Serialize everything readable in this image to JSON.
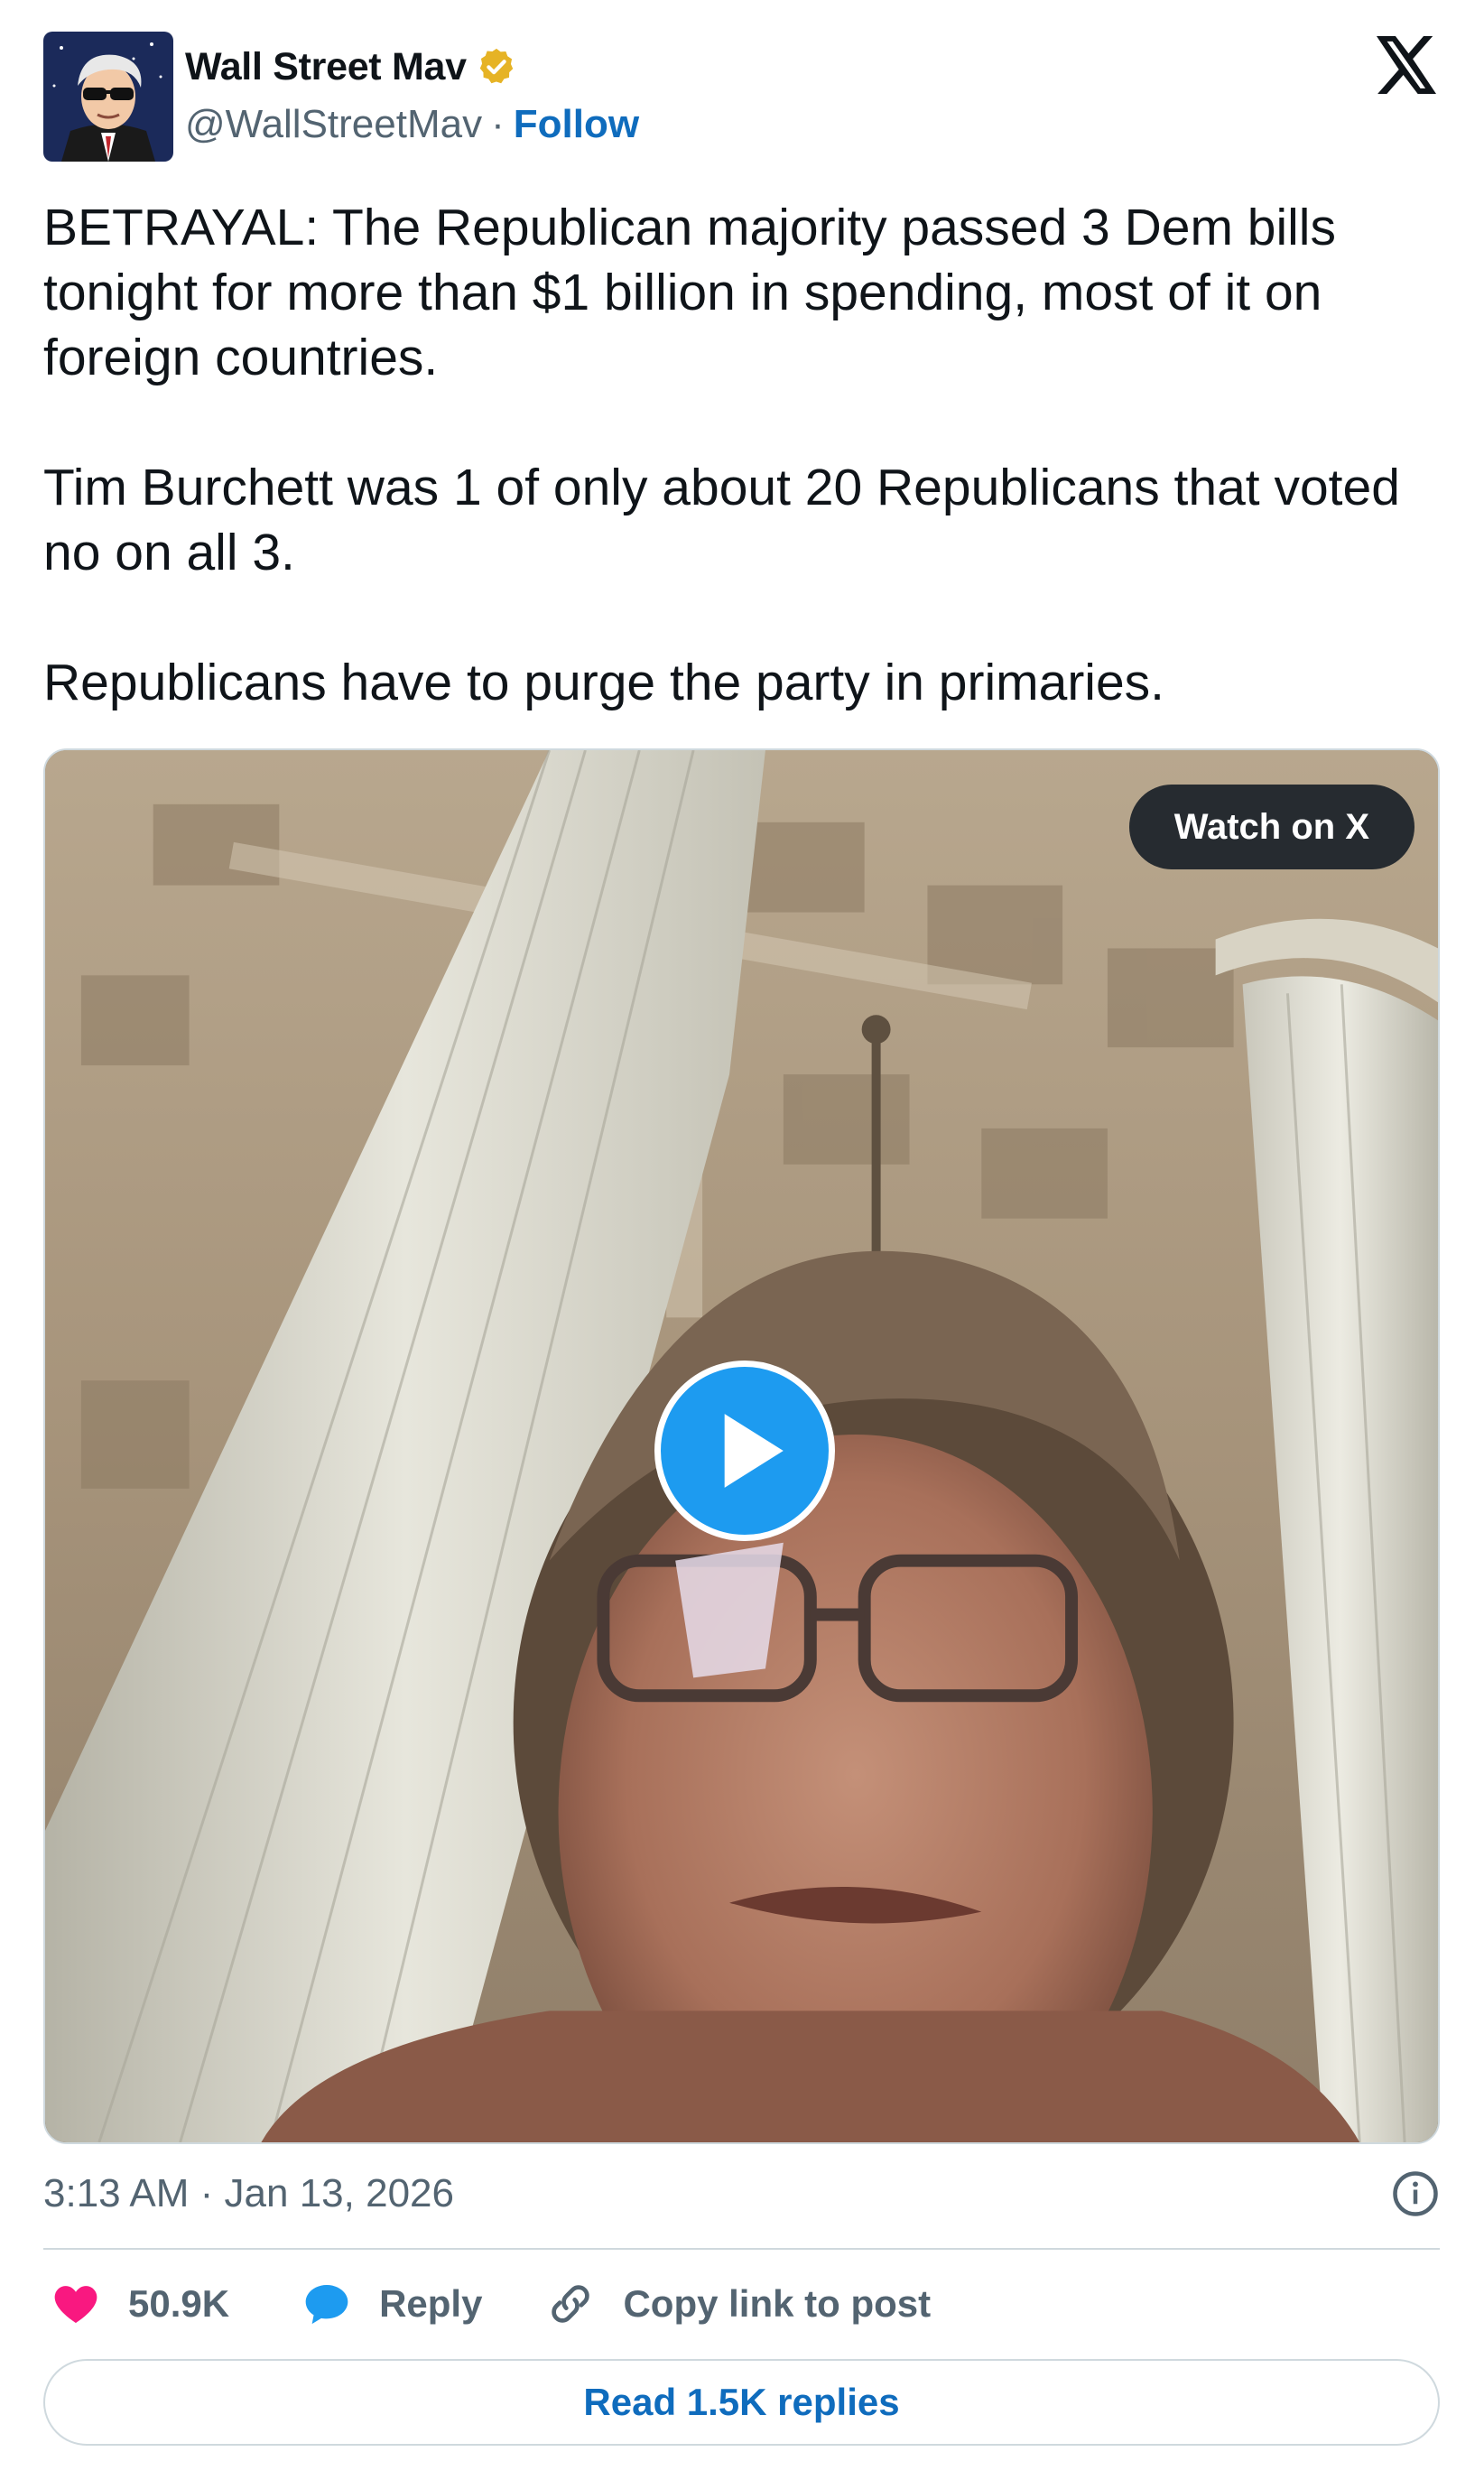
{
  "author": {
    "name": "Wall Street Mav",
    "handle": "@WallStreetMav",
    "separator": "·",
    "follow_label": "Follow",
    "verified_color": "#e6b325"
  },
  "brand": {
    "logo_icon": "x-logo-icon"
  },
  "tweet": {
    "paragraphs": [
      "BETRAYAL: The Republican majority passed 3 Dem bills tonight for more than $1 billion in spending, most of it on foreign countries.",
      "Tim Burchett was 1 of only about 20 Republicans that voted no on all 3.",
      "Republicans have to purge the party in primaries."
    ]
  },
  "media": {
    "watch_label": "Watch on X",
    "play_icon": "play-icon",
    "play_color": "#1d9bf0"
  },
  "meta": {
    "timestamp": "3:13 AM · Jan 13, 2026",
    "info_icon": "info-icon"
  },
  "actions": {
    "likes": "50.9K",
    "reply_label": "Reply",
    "copy_label": "Copy link to post",
    "like_color": "#f91880",
    "reply_color": "#1d9bf0"
  },
  "replies": {
    "read_label": "Read 1.5K replies"
  }
}
